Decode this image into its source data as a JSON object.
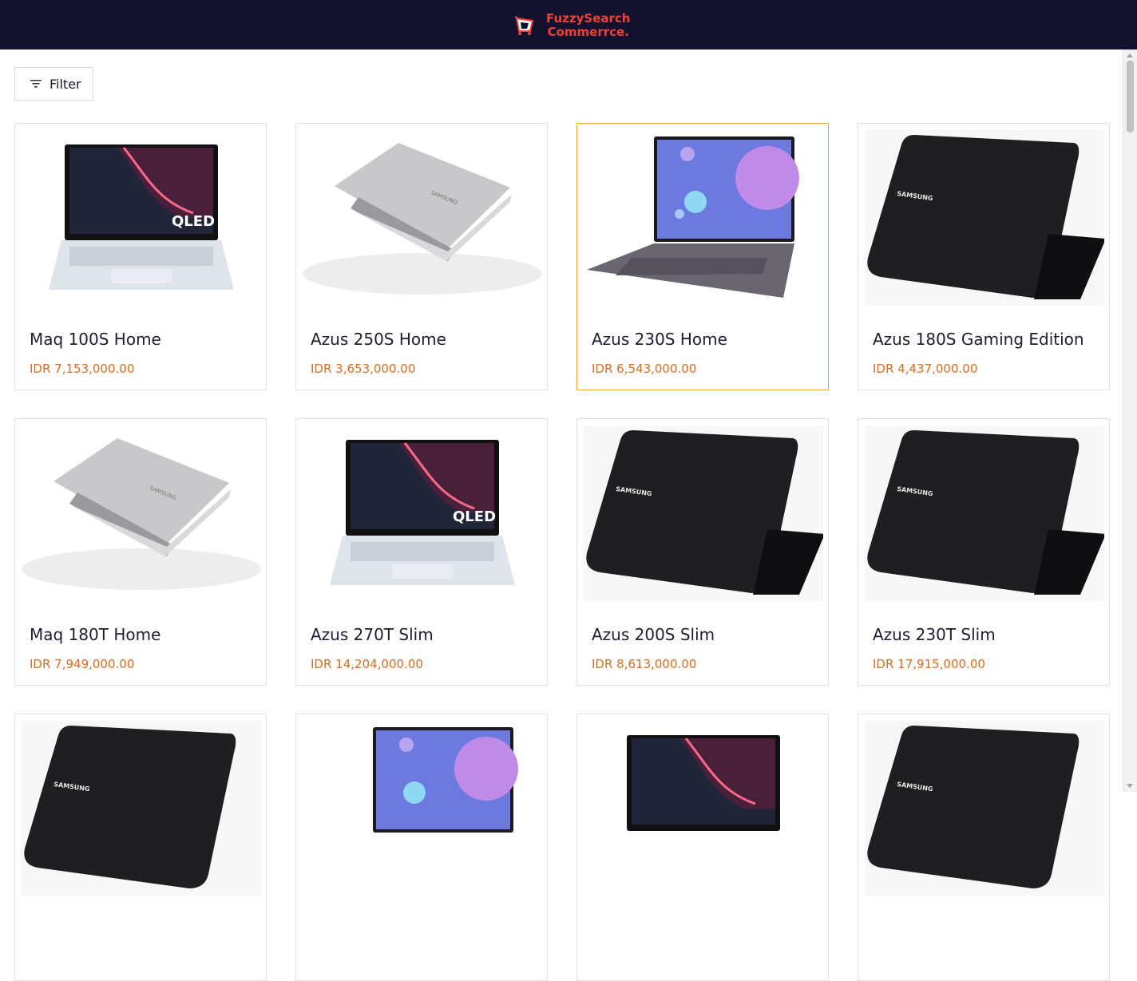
{
  "header": {
    "brand_line1": "FuzzySearch",
    "brand_line2": "Commerrce.",
    "logo_icon": "cart-icon",
    "bg": "#12122e",
    "accent": "#ef4136"
  },
  "toolbar": {
    "filter_label": "Filter",
    "filter_icon": "filter-lines-icon"
  },
  "products": [
    {
      "name": "Maq 100S Home",
      "price": "IDR 7,153,000.00",
      "image": "laptop-qled-front"
    },
    {
      "name": "Azus 250S Home",
      "price": "IDR 3,653,000.00",
      "image": "laptop-silver-floating"
    },
    {
      "name": "Azus 230S Home",
      "price": "IDR 6,543,000.00",
      "image": "laptop-grey-bubbles",
      "highlighted": true
    },
    {
      "name": "Azus 180S Gaming Edition",
      "price": "IDR 4,437,000.00",
      "image": "laptop-black-lid"
    },
    {
      "name": "Maq 180T Home",
      "price": "IDR 7,949,000.00",
      "image": "laptop-silver-floating"
    },
    {
      "name": "Azus 270T Slim",
      "price": "IDR 14,204,000.00",
      "image": "laptop-qled-front"
    },
    {
      "name": "Azus 200S Slim",
      "price": "IDR 8,613,000.00",
      "image": "laptop-black-lid"
    },
    {
      "name": "Azus 230T Slim",
      "price": "IDR 17,915,000.00",
      "image": "laptop-black-lid"
    },
    {
      "name": "",
      "price": "",
      "image": "laptop-black-lid"
    },
    {
      "name": "",
      "price": "",
      "image": "laptop-grey-bubbles"
    },
    {
      "name": "",
      "price": "",
      "image": "laptop-qled-front"
    },
    {
      "name": "",
      "price": "",
      "image": "laptop-black-lid"
    }
  ],
  "colors": {
    "price": "#dd6b20",
    "highlight_border": "#f2a93b"
  },
  "image_text": {
    "qled": "QLED",
    "samsung": "SAMSUNG"
  }
}
